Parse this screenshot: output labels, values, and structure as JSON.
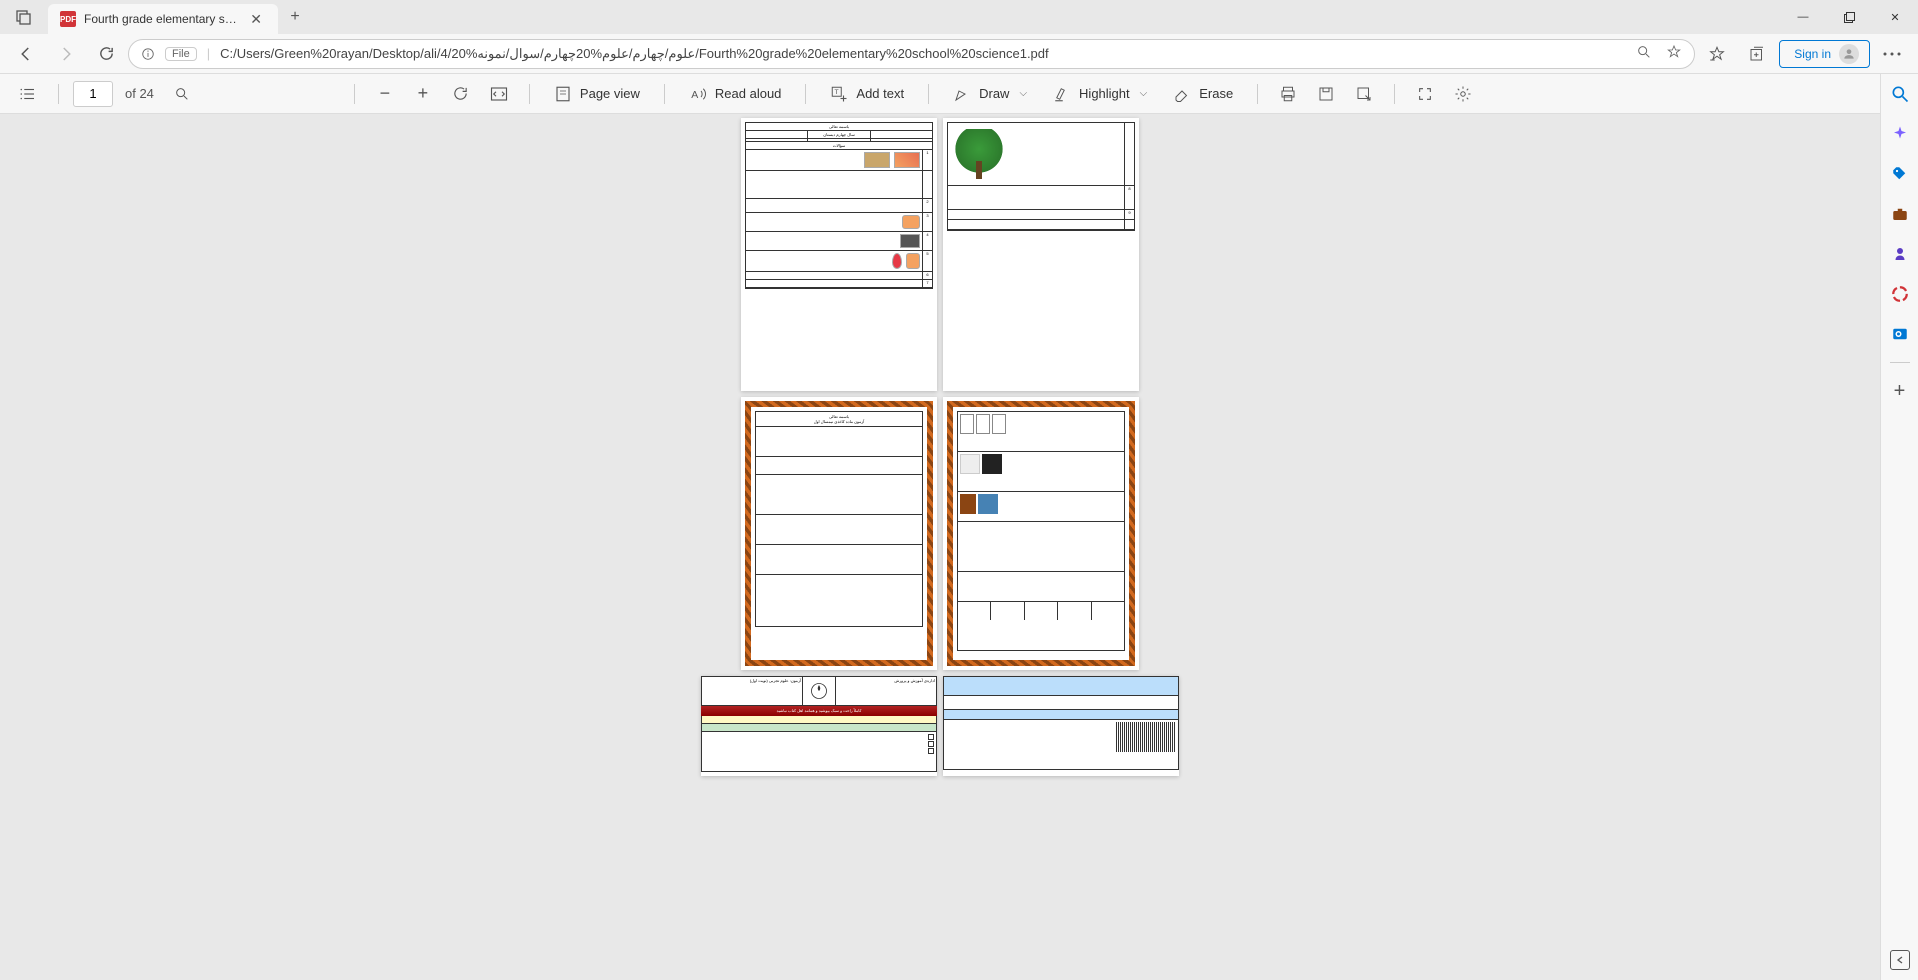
{
  "tab": {
    "title": "Fourth grade elementary school",
    "pdf_badge": "PDF"
  },
  "window_controls": {
    "min": "—",
    "max": "▢",
    "close": "✕"
  },
  "navigation": {
    "back": "←",
    "forward": "→",
    "refresh": "↻"
  },
  "omnibox": {
    "file_label": "File",
    "url": "C:/Users/Green%20rayan/Desktop/ali/4/علوم/چهارم/علوم%20چهارم/سوال/نمونه%20/Fourth%20grade%20elementary%20school%20science1.pdf"
  },
  "signin": {
    "label": "Sign in"
  },
  "pdf_toolbar": {
    "page_current": "1",
    "page_total": "of 24",
    "page_view": "Page view",
    "read_aloud": "Read aloud",
    "add_text": "Add text",
    "draw": "Draw",
    "highlight": "Highlight",
    "erase": "Erase"
  },
  "pages": {
    "p1": {
      "header_title": "باسمه تعالی",
      "header_sub": "سال چهارم دبستان",
      "row_label": "سؤالات"
    },
    "p2": {},
    "p3": {
      "title": "باسمه تعالی",
      "subtitle": "آزمون ماده کاغذی نیمسال اول"
    },
    "p4": {},
    "p5": {
      "exam_label": "آزمون: علوم تجربی (نوبت اول)",
      "org": "اداره‌ی آموزش و پرورش"
    }
  },
  "sidebar_icons": [
    "search",
    "wand",
    "tag",
    "briefcase",
    "person",
    "swirl",
    "outlook",
    "plus"
  ]
}
